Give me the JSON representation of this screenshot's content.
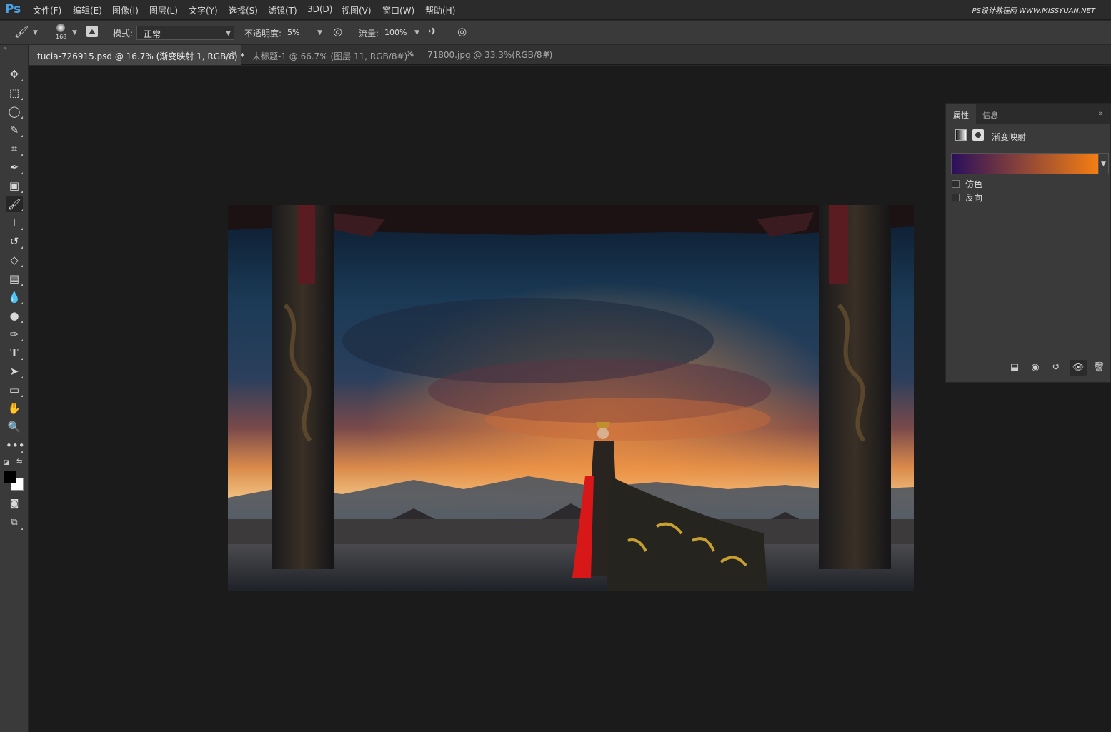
{
  "app": {
    "logo": "Ps"
  },
  "menu": [
    "文件(F)",
    "编辑(E)",
    "图像(I)",
    "图层(L)",
    "文字(Y)",
    "选择(S)",
    "滤镜(T)",
    "3D(D)",
    "视图(V)",
    "窗口(W)",
    "帮助(H)"
  ],
  "watermark": "PS设计教程网  WWW.MISSYUAN.NET",
  "options": {
    "brush_size": "168",
    "mode_label": "模式:",
    "mode_value": "正常",
    "opacity_label": "不透明度:",
    "opacity_value": "5%",
    "flow_label": "流量:",
    "flow_value": "100%"
  },
  "tabs": [
    {
      "label": "tucia-726915.psd @ 16.7% (渐变映射 1, RGB/8) *",
      "active": true
    },
    {
      "label": "未标题-1 @ 66.7% (图层 11, RGB/8#) *",
      "active": false
    },
    {
      "label": "71800.jpg @ 33.3%(RGB/8#)",
      "active": false
    }
  ],
  "toolbar": {
    "tools": [
      "move-tool",
      "marquee-tool",
      "lasso-tool",
      "quick-selection-tool",
      "crop-tool",
      "eyedropper-tool",
      "frame-tool",
      "brush-tool",
      "stamp-tool",
      "history-brush-tool",
      "eraser-tool",
      "gradient-tool",
      "blur-tool",
      "dodge-tool",
      "pen-tool",
      "type-tool",
      "path-selection-tool",
      "rectangle-tool",
      "hand-tool",
      "zoom-tool",
      "more-tools"
    ],
    "active_tool": "brush-tool",
    "foreground_color": "#000000",
    "background_color": "#ffffff"
  },
  "properties": {
    "tab_active": "属性",
    "tab_other": "信息",
    "adjustment_name": "渐变映射",
    "gradient_colors": [
      "#2a0f5c",
      "#f47e12"
    ],
    "checkbox_dither": "仿色",
    "checkbox_reverse": "反向",
    "dither_checked": false,
    "reverse_checked": false
  }
}
